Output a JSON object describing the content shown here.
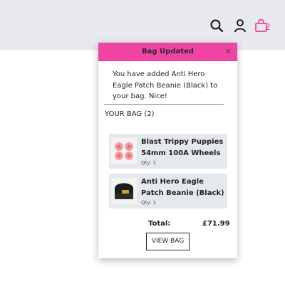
{
  "header": {
    "icons": [
      "search-icon",
      "account-icon",
      "shopping-bag-icon"
    ],
    "bag_count": "2",
    "accent_color": "#e93e9a",
    "bar_color": "#e7e9ec"
  },
  "popup": {
    "title": "Bag Updated",
    "close_symbol": "✕",
    "header_color": "#f044a3",
    "message": "You have added Anti Hero Eagle Patch Beanie (Black) to your bag. Nice!",
    "bag_heading": "YOUR BAG (2)",
    "items": [
      {
        "name": "Blast Trippy Puppies 54mm 100A Wheels",
        "qty": "Qty: 1",
        "thumbnail": "wheels-image"
      },
      {
        "name": "Anti Hero Eagle Patch Beanie (Black)",
        "qty": "Qty: 1",
        "thumbnail": "beanie-image"
      }
    ],
    "total_label": "Total:",
    "total_value": "£71.99",
    "view_bag_label": "VIEW BAG"
  }
}
